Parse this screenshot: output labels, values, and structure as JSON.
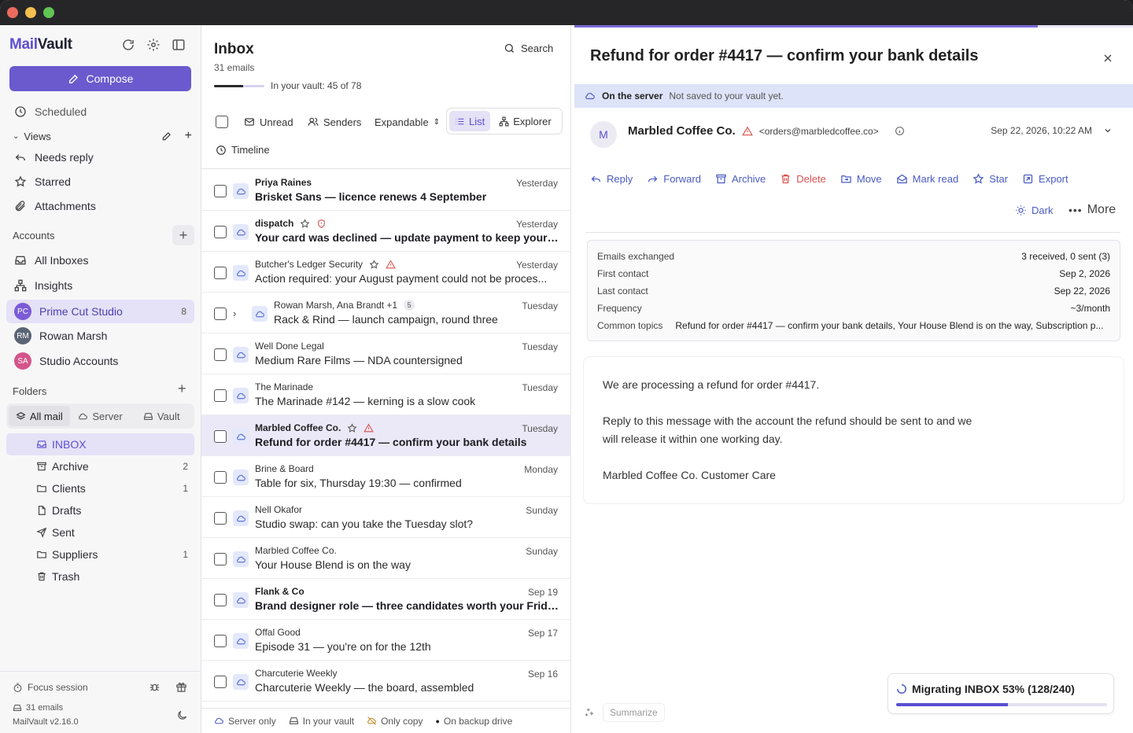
{
  "app": {
    "name_mail": "Mail",
    "name_vault": "Vault"
  },
  "sidebar": {
    "compose": "Compose",
    "scheduled": "Scheduled",
    "views_label": "Views",
    "views": [
      {
        "label": "Needs reply",
        "icon": "reply-icon"
      },
      {
        "label": "Starred",
        "icon": "star-icon"
      },
      {
        "label": "Attachments",
        "icon": "paperclip-icon"
      }
    ],
    "accounts_label": "Accounts",
    "all_inboxes": "All Inboxes",
    "insights": "Insights",
    "accounts": [
      {
        "label": "Prime Cut Studio",
        "initials": "PC",
        "count": "8",
        "color": "#7b5bd6"
      },
      {
        "label": "Rowan Marsh",
        "initials": "RM",
        "count": "",
        "color": "#5b6474"
      },
      {
        "label": "Studio Accounts",
        "initials": "SA",
        "count": "",
        "color": "#d4548a"
      }
    ],
    "folders_label": "Folders",
    "folder_filter": [
      "All mail",
      "Server",
      "Vault"
    ],
    "folders": [
      {
        "label": "INBOX",
        "count": ""
      },
      {
        "label": "Archive",
        "count": "2"
      },
      {
        "label": "Clients",
        "count": "1"
      },
      {
        "label": "Drafts",
        "count": ""
      },
      {
        "label": "Sent",
        "count": ""
      },
      {
        "label": "Suppliers",
        "count": "1"
      },
      {
        "label": "Trash",
        "count": ""
      }
    ],
    "footer": {
      "focus": "Focus session",
      "emails": "31 emails",
      "version": "MailVault v2.16.0"
    }
  },
  "list": {
    "title": "Inbox",
    "count": "31 emails",
    "vault_status": "In your vault: 45 of 78",
    "vault_fraction": 0.577,
    "search": "Search",
    "filters": {
      "unread": "Unread",
      "senders": "Senders",
      "expandable": "Expandable",
      "list": "List",
      "explorer": "Explorer",
      "timeline": "Timeline"
    },
    "emails": [
      {
        "from": "Priya Raines",
        "subject": "Brisket Sans — licence renews 4 September",
        "date": "Yesterday",
        "bold": true,
        "icons": []
      },
      {
        "from": "dispatch",
        "subject": "Your card was declined — update payment to keep your o...",
        "date": "Yesterday",
        "bold": true,
        "icons": [
          "star",
          "shield"
        ]
      },
      {
        "from": "Butcher's Ledger Security",
        "subject": "Action required: your August payment could not be proces...",
        "date": "Yesterday",
        "bold": false,
        "icons": [
          "star",
          "warn"
        ]
      },
      {
        "from": "Rowan Marsh, Ana Brandt +1",
        "subject": "Rack & Rind — launch campaign, round three",
        "date": "Tuesday",
        "bold": false,
        "thread": "5",
        "icons": []
      },
      {
        "from": "Well Done Legal",
        "subject": "Medium Rare Films — NDA countersigned",
        "date": "Tuesday",
        "bold": false,
        "icons": []
      },
      {
        "from": "The Marinade",
        "subject": "The Marinade #142 — kerning is a slow cook",
        "date": "Tuesday",
        "bold": false,
        "icons": []
      },
      {
        "from": "Marbled Coffee Co.",
        "subject": "Refund for order #4417 — confirm your bank details",
        "date": "Tuesday",
        "bold": true,
        "selected": true,
        "icons": [
          "star",
          "warn"
        ]
      },
      {
        "from": "Brine & Board",
        "subject": "Table for six, Thursday 19:30 — confirmed",
        "date": "Monday",
        "bold": false,
        "icons": []
      },
      {
        "from": "Nell Okafor",
        "subject": "Studio swap: can you take the Tuesday slot?",
        "date": "Sunday",
        "bold": false,
        "icons": []
      },
      {
        "from": "Marbled Coffee Co.",
        "subject": "Your House Blend is on the way",
        "date": "Sunday",
        "bold": false,
        "icons": []
      },
      {
        "from": "Flank & Co",
        "subject": "Brand designer role — three candidates worth your Friday",
        "date": "Sep 19",
        "bold": true,
        "icons": []
      },
      {
        "from": "Offal Good",
        "subject": "Episode 31 — you're on for the 12th",
        "date": "Sep 17",
        "bold": false,
        "icons": []
      },
      {
        "from": "Charcuterie Weekly",
        "subject": "Charcuterie Weekly — the board, assembled",
        "date": "Sep 16",
        "bold": false,
        "icons": []
      }
    ],
    "legend": [
      "Server only",
      "In your vault",
      "Only copy",
      "On backup drive"
    ]
  },
  "reading": {
    "progress_fraction": 0.83,
    "subject": "Refund for order #4417 — confirm your bank details",
    "server_title": "On the server",
    "server_note": "Not saved to your vault yet.",
    "sender_initial": "M",
    "sender_name": "Marbled Coffee Co.",
    "sender_addr": "<orders@marbledcoffee.co>",
    "date": "Sep 22, 2026, 10:22 AM",
    "actions": {
      "reply": "Reply",
      "forward": "Forward",
      "archive": "Archive",
      "delete": "Delete",
      "move": "Move",
      "markread": "Mark read",
      "star": "Star",
      "export": "Export",
      "dark": "Dark",
      "more": "More"
    },
    "stats": [
      {
        "k": "Emails exchanged",
        "v": "3 received, 0 sent (3)"
      },
      {
        "k": "First contact",
        "v": "Sep 2, 2026"
      },
      {
        "k": "Last contact",
        "v": "Sep 22, 2026"
      },
      {
        "k": "Frequency",
        "v": "~3/month"
      },
      {
        "k": "Common topics",
        "v": "Refund for order #4417 — confirm your bank details, Your House Blend is on the way, Subscription p..."
      }
    ],
    "body": [
      "We are processing a refund for order #4417.",
      "Reply to this message with the account the refund should be sent to and we will release it within one working day.",
      "Marbled Coffee Co. Customer Care"
    ],
    "migrating": "Migrating INBOX 53% (128/240)",
    "migrating_fraction": 0.53,
    "summarize": "Summarize"
  }
}
